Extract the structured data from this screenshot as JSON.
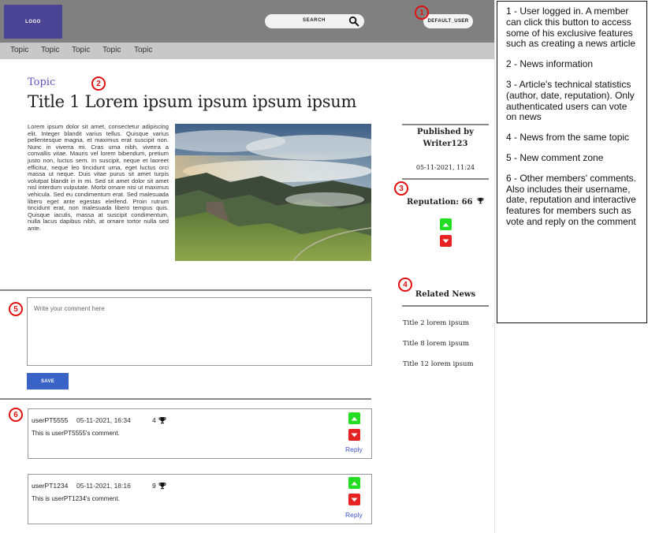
{
  "header": {
    "logo_text": "LOGO",
    "search_label": "SEARCH",
    "user_button": "DEFAULT_USER"
  },
  "topic_nav": [
    "Topic",
    "Topic",
    "Topic",
    "Topic",
    "Topic"
  ],
  "markers": [
    "1",
    "2",
    "3",
    "4",
    "5",
    "6"
  ],
  "article": {
    "topic": "Topic",
    "title": "Title 1 Lorem ipsum ipsum ipsum ipsum",
    "body": "Lorem ipsum dolor sit amet, consectetur adipiscing elit. Integer blandit varius tellus. Quisque varius pellentesque magna, et maximus erat suscipit non. Nunc in viverra mi. Cras urna nibh, viverra a convallis vitae. Mauris vel lorem bibendum, pretium justo non, luctus sem. In suscipit, neque et laoreet efficitur, neque leo tincidunt urna, eget luctus orci massa ut neque. Duis vitae purus sit amet turpis volutpat blandit in in mi. Sed sit amet dolor sit amet nisl interdum vulputate. Morbi ornare nisi ut maximus vehicula. Sed eu condimentum erat. Sed malesuada libero eget ante egestas eleifend. Proin rutrum tincidunt erat, non malesuada libero tempus quis. Quisque iaculis, massa at suscipit condimentum, nulla lacus dapibus nibh, at ornare tortor nulla sed ante."
  },
  "stats": {
    "published_by": "Published by Writer123",
    "date": "05-11-2021, 11:24",
    "reputation": "Reputation: 66"
  },
  "related": {
    "title": "Related News",
    "items": [
      "Title 2 lorem ipsum",
      "Title 8 lorem ipsum",
      "Title 12 lorem ipsum"
    ]
  },
  "comment_form": {
    "placeholder": "Write your comment here",
    "save_label": "SAVE"
  },
  "comments": [
    {
      "user": "userPT5555",
      "date": "05-11-2021, 16:34",
      "reputation": "4",
      "text": "This is userPT5555's comment.",
      "reply": "Reply"
    },
    {
      "user": "userPT1234",
      "date": "05-11-2021, 18:16",
      "reputation": "9",
      "text": "This is userPT1234's comment.",
      "reply": "Reply"
    }
  ],
  "legend": [
    "1 - User logged in. A member can click this button to access some of his exclusive features such as creating a news article",
    "2 - News information",
    "3 - Article's technical statistics (author, date, reputation). Only authenticated users can vote on news",
    "4 - News from the same topic",
    "5 - New comment zone",
    "6 - Other members' comments. Also includes their username, date, reputation and interactive features for members such as vote and reply on the comment"
  ],
  "colors": {
    "header_bg": "#808080",
    "topic_bar_bg": "#c8c8c8",
    "logo_bg": "#4b4494",
    "accent_blue": "#3a63c8",
    "marker_red": "#e01010",
    "upvote_green": "#22dd22",
    "downvote_red": "#e62222"
  },
  "icons": [
    "search-icon",
    "trophy-icon",
    "upvote-icon",
    "downvote-icon"
  ]
}
